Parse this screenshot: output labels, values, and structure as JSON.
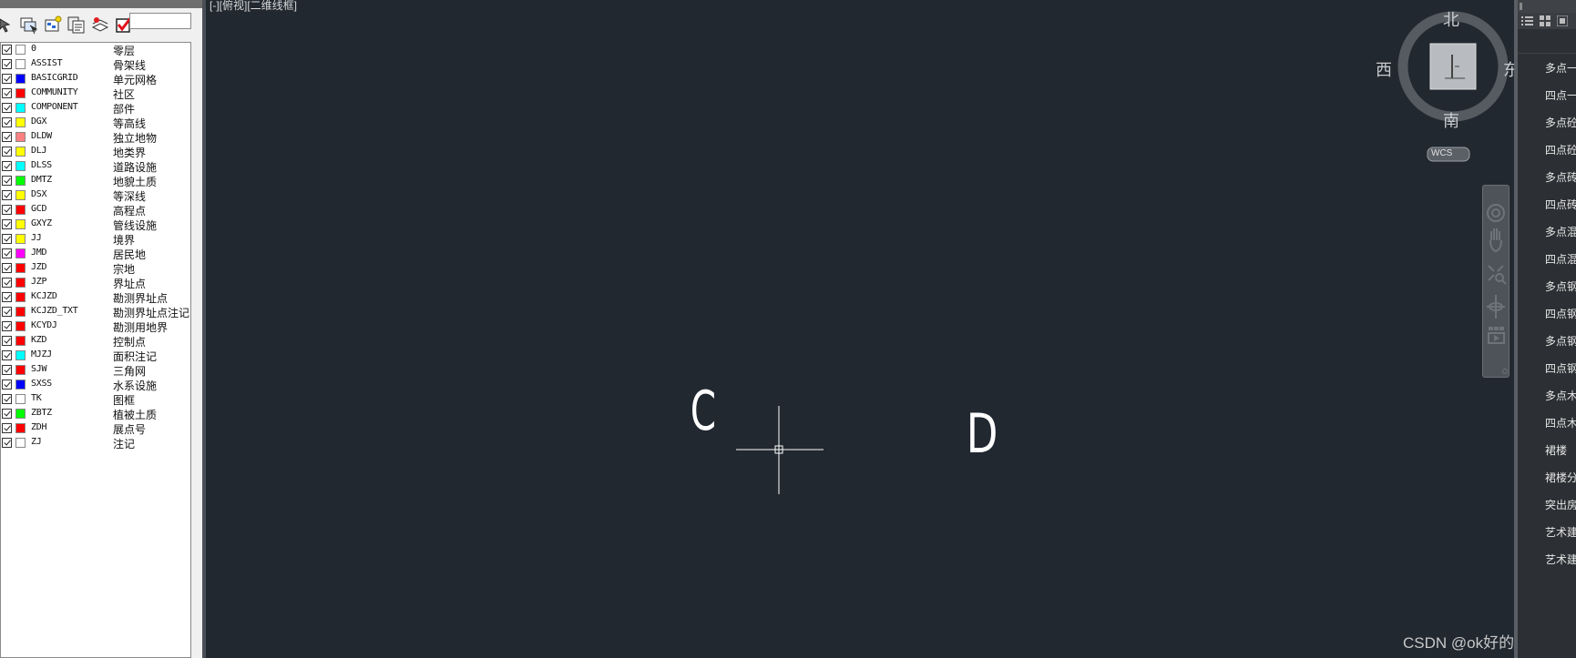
{
  "layer_search": {
    "value": ""
  },
  "layers": [
    {
      "name": "0",
      "desc": "零层",
      "color": "#ffffff"
    },
    {
      "name": "ASSIST",
      "desc": "骨架线",
      "color": "#ffffff"
    },
    {
      "name": "BASICGRID",
      "desc": "单元网格",
      "color": "#0000ff"
    },
    {
      "name": "COMMUNITY",
      "desc": "社区",
      "color": "#ff0000"
    },
    {
      "name": "COMPONENT",
      "desc": "部件",
      "color": "#00ffff"
    },
    {
      "name": "DGX",
      "desc": "等高线",
      "color": "#ffff00"
    },
    {
      "name": "DLDW",
      "desc": "独立地物",
      "color": "#ff8080"
    },
    {
      "name": "DLJ",
      "desc": "地类界",
      "color": "#ffff00"
    },
    {
      "name": "DLSS",
      "desc": "道路设施",
      "color": "#00ffff"
    },
    {
      "name": "DMTZ",
      "desc": "地貌土质",
      "color": "#00ff00"
    },
    {
      "name": "DSX",
      "desc": "等深线",
      "color": "#ffff00"
    },
    {
      "name": "GCD",
      "desc": "高程点",
      "color": "#ff0000"
    },
    {
      "name": "GXYZ",
      "desc": "管线设施",
      "color": "#ffff00"
    },
    {
      "name": "JJ",
      "desc": "境界",
      "color": "#ffff00"
    },
    {
      "name": "JMD",
      "desc": "居民地",
      "color": "#ff00ff"
    },
    {
      "name": "JZD",
      "desc": "宗地",
      "color": "#ff0000"
    },
    {
      "name": "JZP",
      "desc": "界址点",
      "color": "#ff0000"
    },
    {
      "name": "KCJZD",
      "desc": "勘测界址点",
      "color": "#ff0000"
    },
    {
      "name": "KCJZD_TXT",
      "desc": "勘测界址点注记",
      "color": "#ff0000"
    },
    {
      "name": "KCYDJ",
      "desc": "勘测用地界",
      "color": "#ff0000"
    },
    {
      "name": "KZD",
      "desc": "控制点",
      "color": "#ff0000"
    },
    {
      "name": "MJZJ",
      "desc": "面积注记",
      "color": "#00ffff"
    },
    {
      "name": "SJW",
      "desc": "三角网",
      "color": "#ff0000"
    },
    {
      "name": "SXSS",
      "desc": "水系设施",
      "color": "#0000ff"
    },
    {
      "name": "TK",
      "desc": "图框",
      "color": "#ffffff"
    },
    {
      "name": "ZBTZ",
      "desc": "植被土质",
      "color": "#00ff00"
    },
    {
      "name": "ZDH",
      "desc": "展点号",
      "color": "#ff0000"
    },
    {
      "name": "ZJ",
      "desc": "注记",
      "color": "#ffffff"
    }
  ],
  "viewport": {
    "label": "[-][俯视][二维线框]",
    "label_c": "C",
    "label_d": "D"
  },
  "viewcube": {
    "north": "北",
    "south": "南",
    "east": "东",
    "west": "西",
    "wcs": "WCS"
  },
  "right_panel": {
    "items": [
      "多点一",
      "四点一",
      "多点砼",
      "四点砼",
      "多点砖",
      "四点砖",
      "多点混",
      "四点混",
      "多点钢",
      "四点钢",
      "多点钢",
      "四点钢",
      "多点木",
      "四点木",
      "裙楼",
      "裙楼分",
      "突出房",
      "艺术建",
      "艺术建"
    ]
  },
  "watermark": "CSDN @ok好的佩奇",
  "colors": {
    "viewport_bg": "#212830",
    "panel_bg": "#f0f0f0"
  }
}
